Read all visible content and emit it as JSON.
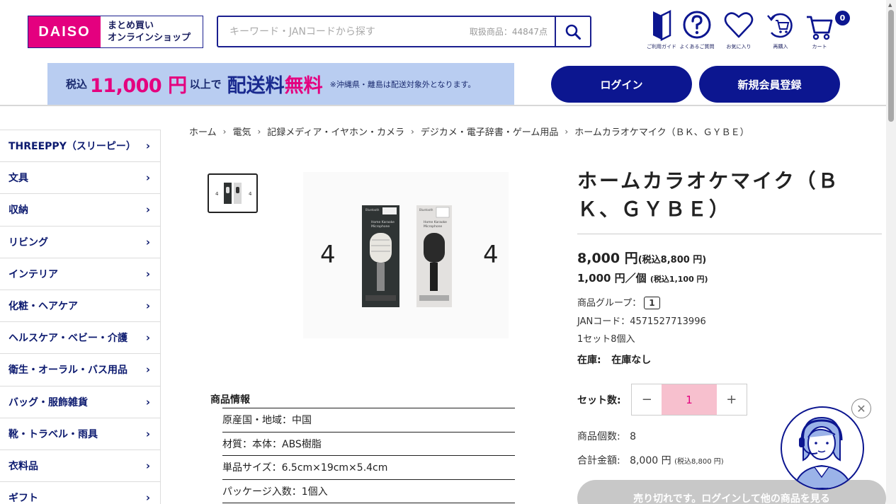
{
  "header": {
    "logo_brand": "DAISO",
    "logo_line1": "まとめ買い",
    "logo_line2": "オンラインショップ",
    "search_placeholder": "キーワード・JANコードから探す",
    "search_count": "取扱商品：44847点",
    "nav": [
      {
        "label": "ご利用ガイド",
        "icon": "guide-icon"
      },
      {
        "label": "よくあるご質問",
        "icon": "question-icon"
      },
      {
        "label": "お気に入り",
        "icon": "heart-icon"
      },
      {
        "label": "再購入",
        "icon": "rebuy-icon"
      },
      {
        "label": "カート",
        "icon": "cart-icon"
      }
    ],
    "cart_count": "0",
    "promo": {
      "p1": "税込",
      "p2": "11,000 円",
      "p3": "以上で",
      "p4": "配送料",
      "p5": "無料",
      "p6": "※沖縄県・離島は配送対象外となります。"
    },
    "login_label": "ログイン",
    "register_label": "新規会員登録"
  },
  "sidebar": {
    "items": [
      {
        "label": "THREEPPY（スリーピー）"
      },
      {
        "label": "文具"
      },
      {
        "label": "収納"
      },
      {
        "label": "リビング"
      },
      {
        "label": "インテリア"
      },
      {
        "label": "化粧・ヘアケア"
      },
      {
        "label": "ヘルスケア・ベビー・介護"
      },
      {
        "label": "衛生・オーラル・バス用品"
      },
      {
        "label": "バッグ・服飾雑貨"
      },
      {
        "label": "靴・トラベル・雨具"
      },
      {
        "label": "衣料品"
      },
      {
        "label": "ギフト"
      }
    ]
  },
  "breadcrumb": [
    "ホーム",
    "電気",
    "記録メディア・イヤホン・カメラ",
    "デジカメ・電子辞書・ゲーム用品",
    "ホームカラオケマイク（ＢＫ、ＧＹＢＥ）"
  ],
  "gallery": {
    "left_number": "4",
    "right_number": "4",
    "box_brand": "Bluetooth",
    "box_name_line1": "Home Karaoke",
    "box_name_line2": "Microphone"
  },
  "product": {
    "title": "ホームカラオケマイク（ＢＫ、ＧＹＢＥ）",
    "price_main": "8,000 円",
    "price_main_tax": "(税込8,800 円)",
    "price_unit": "1,000 円／個",
    "price_unit_tax": "(税込1,100 円)",
    "group_label": "商品グループ：",
    "group_value": "1",
    "jan": "JANコード：4571527713996",
    "set_info": "1セット8個入",
    "stock_label": "在庫:",
    "stock_value": "在庫なし",
    "qty_label": "セット数:",
    "qty_value": "1",
    "count_label": "商品個数:",
    "count_value": "8",
    "total_label": "合計金額:",
    "total_value": "8,000 円",
    "total_tax": "(税込8,800 円)",
    "soldout_label": "売り切れです。ログインして他の商品を見る"
  },
  "details": {
    "heading": "商品情報",
    "rows": [
      "原産国・地域：中国",
      "材質：本体：ABS樹脂",
      "単品サイズ：6.5cm×19cm×5.4cm",
      "パッケージ入数：1個入"
    ]
  },
  "colors": {
    "brand_navy": "#0c1690",
    "brand_pink": "#e4007f",
    "promo_bg": "#b9cdf1"
  }
}
